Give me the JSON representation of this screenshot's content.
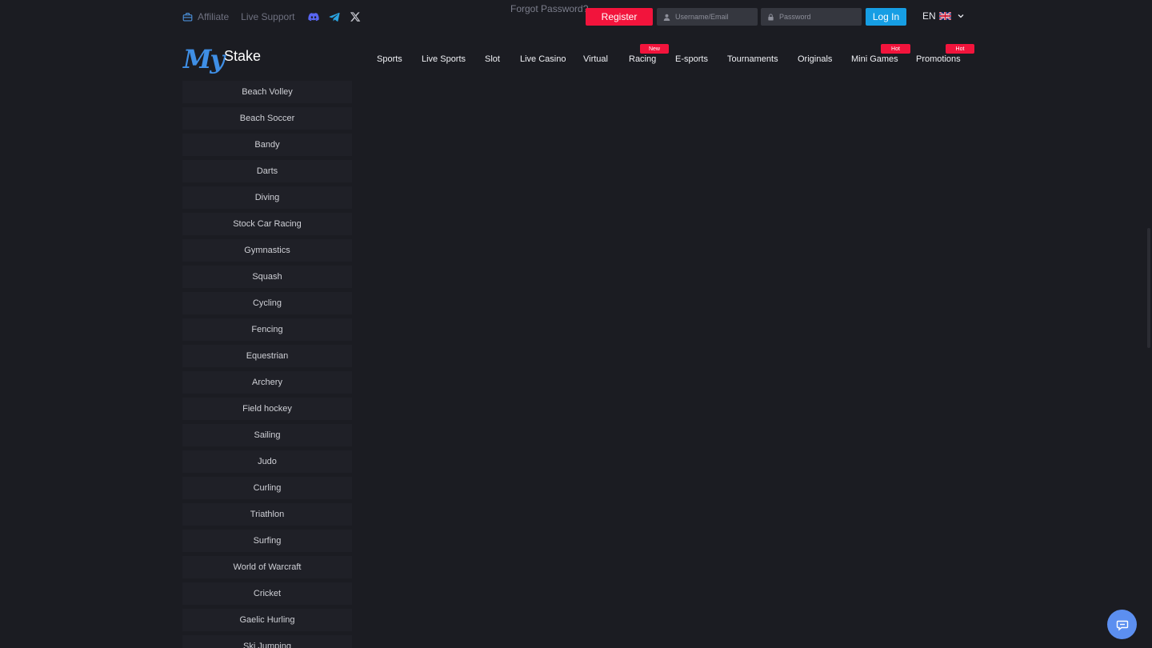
{
  "topbar": {
    "affiliate_label": "Affiliate",
    "live_support_label": "Live Support",
    "social_icons": [
      "discord-icon",
      "telegram-icon",
      "x-icon"
    ],
    "forgot_password_label": "Forgot Password?",
    "register_label": "Register",
    "username_placeholder": "Username/Email",
    "password_placeholder": "Password",
    "login_label": "Log In",
    "language_label": "EN"
  },
  "logo": {
    "primary": "My",
    "secondary": "Stake"
  },
  "nav": {
    "items": [
      {
        "label": "Sports"
      },
      {
        "label": "Live Sports"
      },
      {
        "label": "Slot"
      },
      {
        "label": "Live Casino"
      },
      {
        "label": "Virtual"
      },
      {
        "label": "Racing",
        "badge": "New"
      },
      {
        "label": "E-sports"
      },
      {
        "label": "Tournaments"
      },
      {
        "label": "Originals"
      },
      {
        "label": "Mini Games",
        "badge": "Hot"
      },
      {
        "label": "Promotions",
        "badge": "Hot"
      }
    ]
  },
  "sidebar": {
    "items": [
      "Beach Volley",
      "Beach Soccer",
      "Bandy",
      "Darts",
      "Diving",
      "Stock Car Racing",
      "Gymnastics",
      "Squash",
      "Cycling",
      "Fencing",
      "Equestrian",
      "Archery",
      "Field hockey",
      "Sailing",
      "Judo",
      "Curling",
      "Triathlon",
      "Surfing",
      "World of Warcraft",
      "Cricket",
      "Gaelic Hurling",
      "Ski Jumping"
    ]
  },
  "colors": {
    "background": "#1b1c22",
    "register": "#f2143c",
    "login": "#169ee4",
    "badge": "#f2143c",
    "logo_accent": "#3f8fe6",
    "chat": "#5c8ff0"
  },
  "chat": {
    "icon": "chat-icon"
  }
}
